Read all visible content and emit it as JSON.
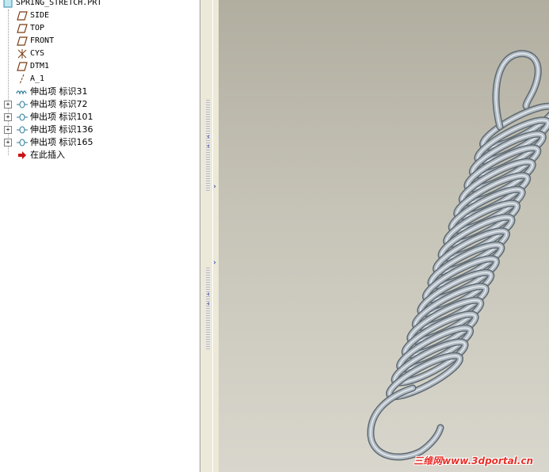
{
  "model_tree": {
    "root_label": "SPRING_STRETCH.PRT",
    "datums": [
      {
        "label": "SIDE",
        "icon": "datum-plane-icon"
      },
      {
        "label": "TOP",
        "icon": "datum-plane-icon"
      },
      {
        "label": "FRONT",
        "icon": "datum-plane-icon"
      },
      {
        "label": "CYS",
        "icon": "coordinate-system-icon"
      },
      {
        "label": "DTM1",
        "icon": "datum-plane-icon"
      },
      {
        "label": "A_1",
        "icon": "datum-axis-icon"
      }
    ],
    "features": [
      {
        "label": "伸出项 标识31",
        "icon": "sweep-feature-icon",
        "expandable": false
      },
      {
        "label": "伸出项 标识72",
        "icon": "protrusion-feature-icon",
        "expandable": true
      },
      {
        "label": "伸出项 标识101",
        "icon": "protrusion-feature-icon",
        "expandable": true
      },
      {
        "label": "伸出项 标识136",
        "icon": "protrusion-feature-icon",
        "expandable": true
      },
      {
        "label": "伸出项 标识165",
        "icon": "protrusion-feature-icon",
        "expandable": true
      }
    ],
    "insert_here": {
      "label": "在此插入",
      "icon": "insert-arrow-icon",
      "color": "#cc1010"
    }
  },
  "splitter": {
    "arrows": [
      "‹",
      "‹",
      "›",
      "›",
      "‹",
      "‹"
    ]
  },
  "viewport": {
    "model": "tension-spring-model",
    "background_top": "#b1aea0",
    "background_bottom": "#d9d7cd",
    "spring_color": "#9fa8b0",
    "watermark": "三维网www.3dportal.cn"
  }
}
